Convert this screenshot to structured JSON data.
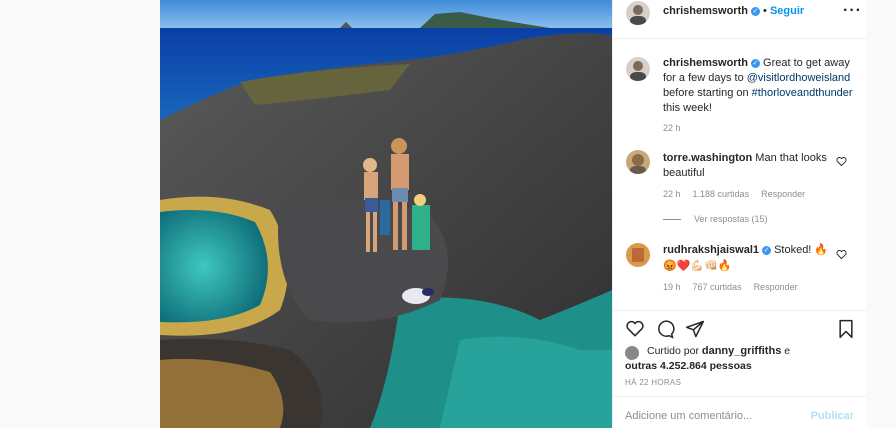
{
  "post": {
    "author": "chrishemsworth",
    "follow_label": "Seguir",
    "caption_prefix": "Great to get away for a few days to ",
    "caption_mention": "@visitlordhoweisland",
    "caption_middle": " before starting on ",
    "caption_hashtag": "#thorloveandthunder",
    "caption_suffix": " this week!",
    "caption_time": "22 h"
  },
  "comments": [
    {
      "user": "torre.washington",
      "text": "Man that looks beautiful",
      "time": "22 h",
      "likes": "1.188 curtidas",
      "reply": "Responder",
      "view_replies": "Ver respostas (15)"
    },
    {
      "user": "rudhrakshjaiswal1",
      "text": "Stoked! 🔥",
      "emojis": "😡❤️💪🏻👊🏻🔥",
      "time": "19 h",
      "likes": "767 curtidas",
      "reply": "Responder"
    }
  ],
  "likes": {
    "prefix": "Curtido por ",
    "user": "danny_griffiths",
    "mid": " e",
    "others": "outras 4.252.864 pessoas"
  },
  "timestamp": "HÁ 22 HORAS",
  "add_comment": {
    "placeholder": "Adicione um comentário...",
    "publish": "Publicar"
  },
  "icons": [
    "more-icon",
    "heart-icon",
    "comment-icon",
    "share-icon",
    "bookmark-icon",
    "verified-icon",
    "chevron-right-icon"
  ],
  "colors": {
    "accent": "#3897f0",
    "link": "#00376b",
    "muted": "#8e8e8e"
  }
}
